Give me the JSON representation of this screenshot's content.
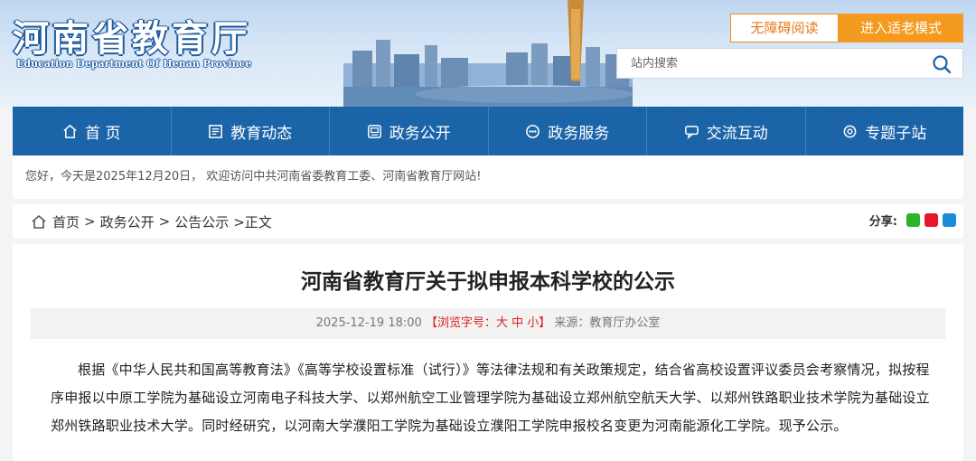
{
  "header": {
    "logo_cn": "河南省教育厅",
    "logo_en": "Education Department Of Henan Province",
    "accessibility_label": "无障碍阅读",
    "elder_mode_label": "进入适老模式",
    "search_placeholder": "站内搜索",
    "search_icon": "search-icon"
  },
  "nav": {
    "items": [
      {
        "label": "首 页",
        "icon": "home-icon"
      },
      {
        "label": "教育动态",
        "icon": "news-icon"
      },
      {
        "label": "政务公开",
        "icon": "document-icon"
      },
      {
        "label": "政务服务",
        "icon": "service-icon"
      },
      {
        "label": "交流互动",
        "icon": "chat-icon"
      },
      {
        "label": "专题子站",
        "icon": "topic-icon"
      }
    ]
  },
  "welcome": "您好，今天是2025年12月20日， 欢迎访问中共河南省委教育工委、河南省教育厅网站!",
  "breadcrumb": {
    "home": "首页",
    "sep1": ">",
    "level1": "政务公开",
    "sep2": ">",
    "level2": "公告公示",
    "current": ">正文"
  },
  "share": {
    "label": "分享:",
    "icons": [
      "wechat-icon",
      "weibo-icon",
      "qq-icon"
    ],
    "colors": [
      "#2bb32b",
      "#e6162d",
      "#1e8cd8"
    ]
  },
  "article": {
    "title": "河南省教育厅关于拟申报本科学校的公示",
    "date": "2025-12-19 18:00",
    "font_size_label": "【浏览字号：大 中 小】",
    "source": "来源：教育厅办公室",
    "body": "根据《中华人民共和国高等教育法》《高等学校设置标准（试行）》等法律法规和有关政策规定，结合省高校设置评议委员会考察情况，拟按程序申报以中原工学院为基础设立河南电子科技大学、以郑州航空工业管理学院为基础设立郑州航空航天大学、以郑州铁路职业技术学院为基础设立郑州铁路职业技术大学。同时经研究，以河南大学濮阳工学院为基础设立濮阳工学院申报校名变更为河南能源化工学院。现予公示。"
  },
  "colors": {
    "nav_bg": "#1c64a8",
    "accent_orange": "#f39a1f",
    "highlight_red": "#d22222"
  }
}
